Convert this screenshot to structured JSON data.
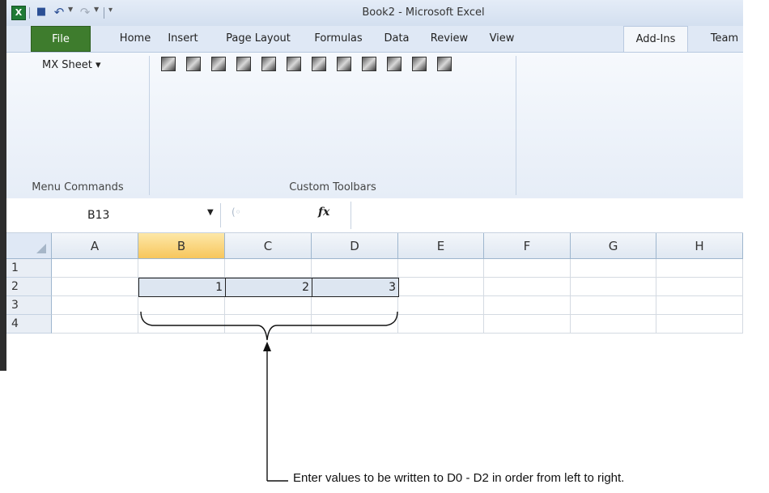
{
  "window": {
    "title": "Book2 - Microsoft Excel",
    "app_icon": "X"
  },
  "quick_access": {
    "icons": [
      "excel-icon",
      "save-icon",
      "undo-icon",
      "redo-icon",
      "customize-qat-icon"
    ]
  },
  "ribbon_tabs": [
    "File",
    "Home",
    "Insert",
    "Page Layout",
    "Formulas",
    "Data",
    "Review",
    "View",
    "Add-Ins",
    "Team"
  ],
  "active_tab": "Add-Ins",
  "ribbon": {
    "menu_commands": {
      "button_label": "MX Sheet ▾",
      "group_label": "Menu Commands"
    },
    "custom_toolbars": {
      "group_label": "Custom Toolbars",
      "icon_count": 12
    }
  },
  "formula_bar": {
    "name_box": "B13",
    "fx_label": "fx",
    "formula": ""
  },
  "sheet": {
    "columns": [
      "A",
      "B",
      "C",
      "D",
      "E",
      "F",
      "G",
      "H"
    ],
    "selected_column": "B",
    "rows": [
      "1",
      "2",
      "3",
      "4"
    ],
    "row2_values": {
      "B": "1",
      "C": "2",
      "D": "3"
    }
  },
  "annotation": {
    "text": "Enter values to be written to D0 - D2  in order from left to right."
  },
  "colors": {
    "file_tab": "#3e7c2d",
    "selected_header": "#f7c65c",
    "value_cells": "#dde6f1"
  }
}
